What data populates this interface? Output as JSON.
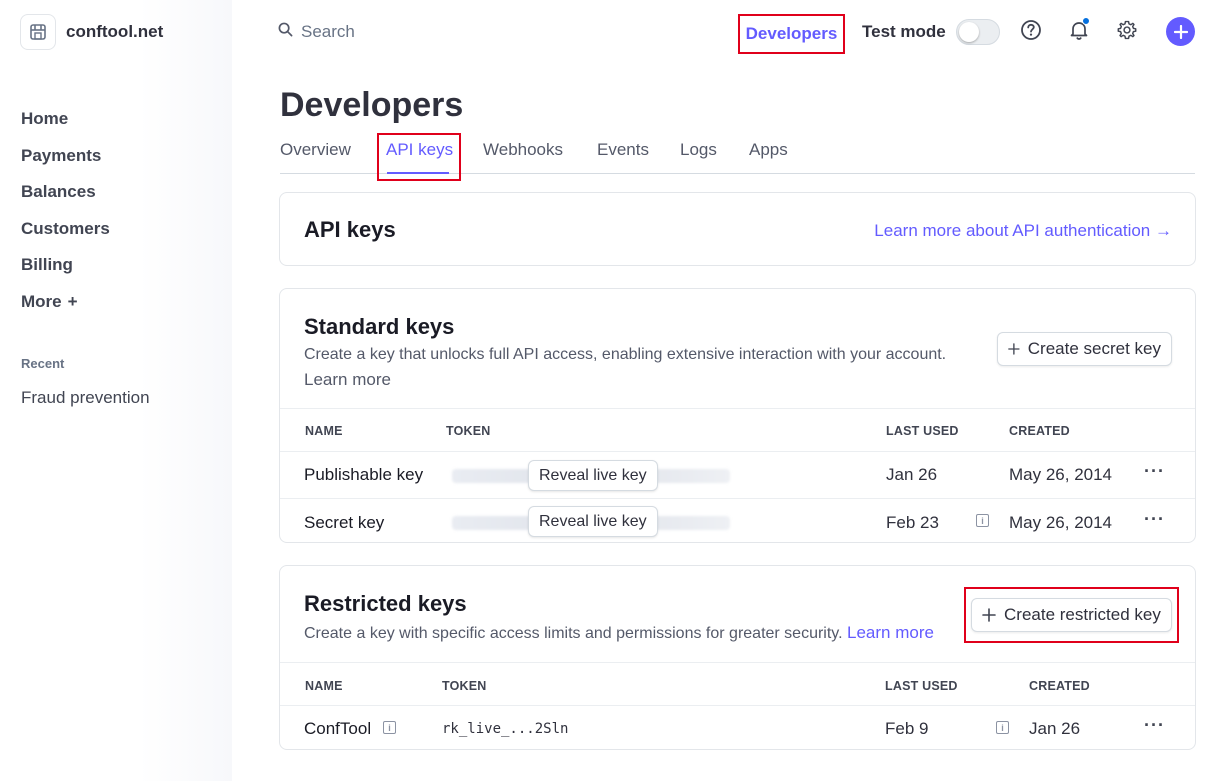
{
  "brand": {
    "name": "conftool.net"
  },
  "sidebar": {
    "items": [
      {
        "label": "Home"
      },
      {
        "label": "Payments"
      },
      {
        "label": "Balances"
      },
      {
        "label": "Customers"
      },
      {
        "label": "Billing"
      },
      {
        "label": "More"
      }
    ],
    "recent_label": "Recent",
    "recent_items": [
      {
        "label": "Fraud prevention"
      }
    ]
  },
  "header": {
    "search_placeholder": "Search",
    "developers_label": "Developers",
    "test_mode_label": "Test mode",
    "test_mode_on": false
  },
  "page": {
    "title": "Developers",
    "tabs": [
      {
        "label": "Overview"
      },
      {
        "label": "API keys",
        "active": true
      },
      {
        "label": "Webhooks"
      },
      {
        "label": "Events"
      },
      {
        "label": "Logs"
      },
      {
        "label": "Apps"
      }
    ]
  },
  "api_keys_card": {
    "title": "API keys",
    "learn_more_link": "Learn more about API authentication →"
  },
  "standard_keys": {
    "title": "Standard keys",
    "description": "Create a key that unlocks full API access, enabling extensive interaction with your account.",
    "learn_more": "Learn more",
    "create_button": "Create secret key",
    "columns": {
      "name": "NAME",
      "token": "TOKEN",
      "last_used": "LAST USED",
      "created": "CREATED"
    },
    "rows": [
      {
        "name": "Publishable key",
        "reveal": "Reveal live key",
        "last_used": "Jan 26",
        "created": "May 26, 2014"
      },
      {
        "name": "Secret key",
        "reveal": "Reveal live key",
        "last_used": "Feb 23",
        "created": "May 26, 2014"
      }
    ]
  },
  "restricted_keys": {
    "title": "Restricted keys",
    "description": "Create a key with specific access limits and permissions for greater security.",
    "learn_more": "Learn more",
    "create_button": "Create restricted key",
    "columns": {
      "name": "NAME",
      "token": "TOKEN",
      "last_used": "LAST USED",
      "created": "CREATED"
    },
    "rows": [
      {
        "name": "ConfTool",
        "token": "rk_live_...2Sln",
        "last_used": "Feb 9",
        "created": "Jan 26"
      }
    ]
  },
  "more_menu_glyph": "···",
  "colors": {
    "accent": "#635bff",
    "highlight": "#e0001b",
    "notification": "#0570de"
  },
  "icons": [
    "store-icon",
    "search-icon",
    "help-icon",
    "bell-icon",
    "gear-icon",
    "plus-icon",
    "info-icon",
    "more-icon"
  ]
}
